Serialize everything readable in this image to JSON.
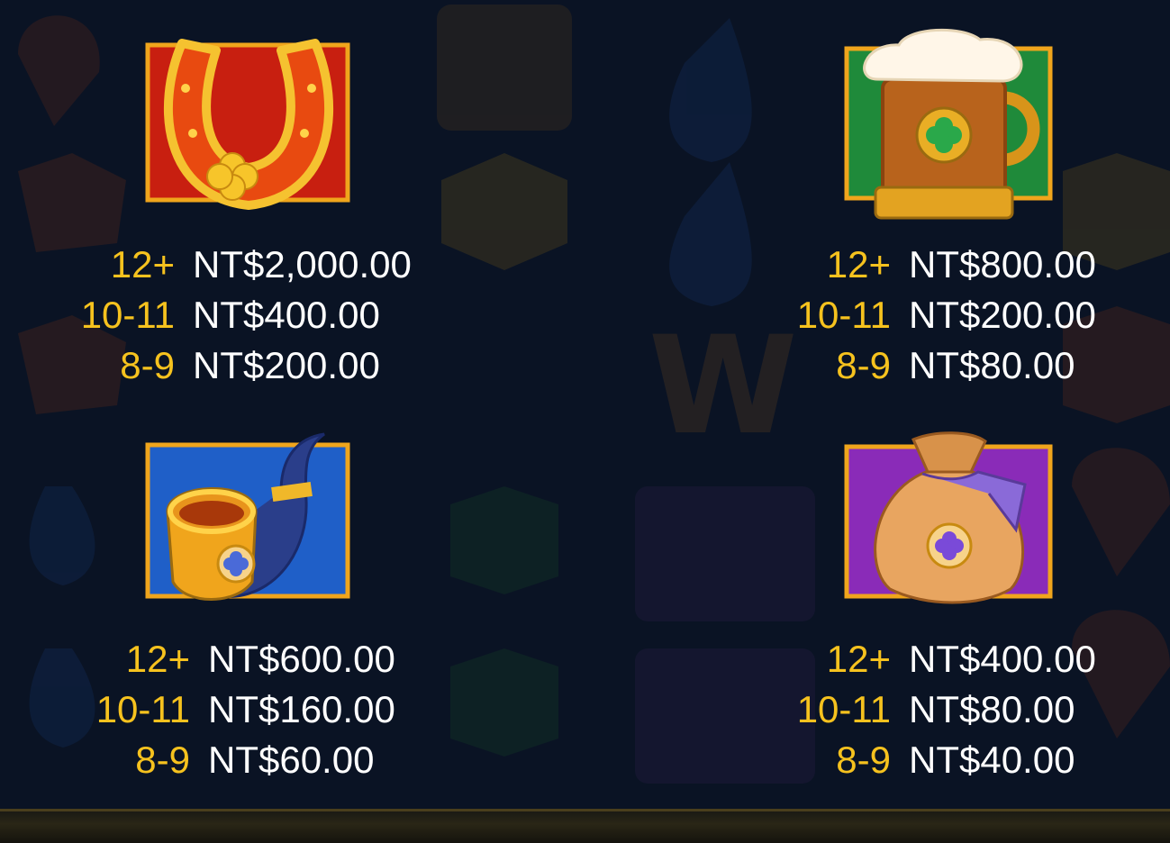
{
  "paytable": [
    {
      "symbol": "horseshoe-icon",
      "rows": [
        {
          "count": "12+",
          "amount": "NT$2,000.00"
        },
        {
          "count": "10-11",
          "amount": "NT$400.00"
        },
        {
          "count": "8-9",
          "amount": "NT$200.00"
        }
      ]
    },
    {
      "symbol": "beer-mug-icon",
      "rows": [
        {
          "count": "12+",
          "amount": "NT$800.00"
        },
        {
          "count": "10-11",
          "amount": "NT$200.00"
        },
        {
          "count": "8-9",
          "amount": "NT$80.00"
        }
      ]
    },
    {
      "symbol": "pipe-icon",
      "rows": [
        {
          "count": "12+",
          "amount": "NT$600.00"
        },
        {
          "count": "10-11",
          "amount": "NT$160.00"
        },
        {
          "count": "8-9",
          "amount": "NT$60.00"
        }
      ]
    },
    {
      "symbol": "money-bag-icon",
      "rows": [
        {
          "count": "12+",
          "amount": "NT$400.00"
        },
        {
          "count": "10-11",
          "amount": "NT$80.00"
        },
        {
          "count": "8-9",
          "amount": "NT$40.00"
        }
      ]
    }
  ],
  "colors": {
    "background": "#0b1426",
    "count_text": "#f6c21e",
    "amount_text": "#ffffff",
    "frame_gold": "#f0a51c",
    "horseshoe_panel": "#c81f10",
    "beer_panel": "#1f8a3a",
    "pipe_panel": "#1f5fc8",
    "bag_panel": "#8a2bb8"
  }
}
